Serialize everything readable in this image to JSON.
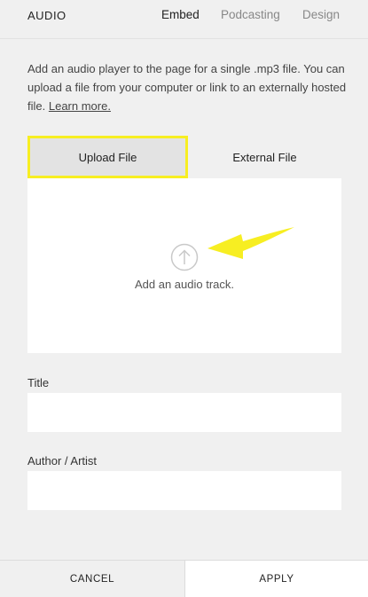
{
  "header": {
    "title": "AUDIO",
    "tabs": [
      {
        "label": "Embed",
        "active": true
      },
      {
        "label": "Podcasting",
        "active": false
      },
      {
        "label": "Design",
        "active": false
      }
    ]
  },
  "description": {
    "text": "Add an audio player to the page for a single .mp3 file. You can upload a file from your computer or link to an externally hosted file.",
    "link": "Learn more."
  },
  "source_tabs": [
    {
      "label": "Upload File",
      "active": true
    },
    {
      "label": "External File",
      "active": false
    }
  ],
  "upload": {
    "icon": "upload-arrow-icon",
    "text": "Add an audio track."
  },
  "annotation": {
    "icon": "pointer-arrow-icon",
    "color": "#f7ee22"
  },
  "fields": {
    "title_label": "Title",
    "title_value": "",
    "artist_label": "Author / Artist",
    "artist_value": ""
  },
  "footer": {
    "cancel_label": "CANCEL",
    "apply_label": "APPLY"
  }
}
